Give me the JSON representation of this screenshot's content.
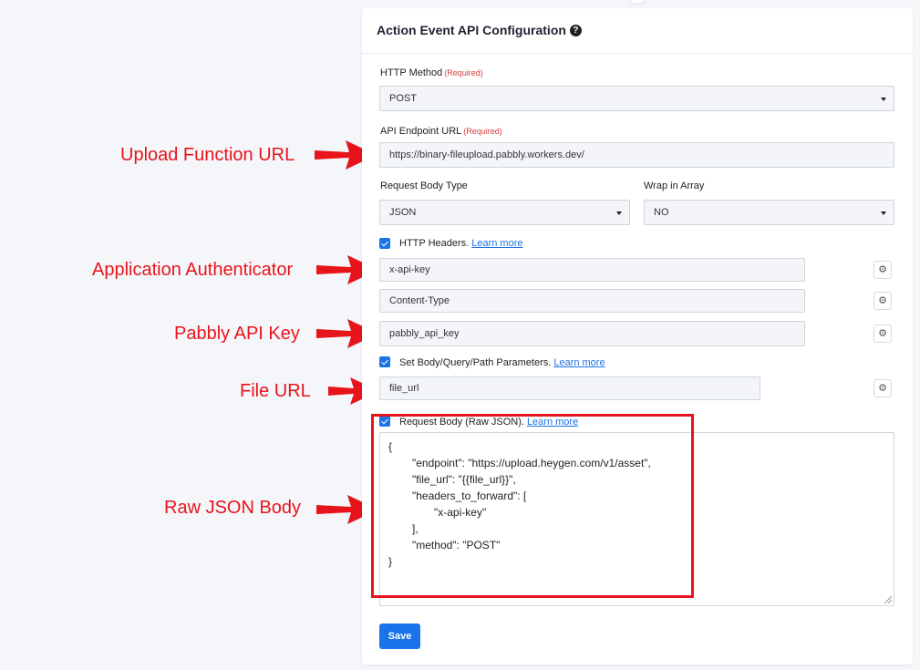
{
  "panel": {
    "title": "Action Event API Configuration",
    "help_icon": "question-circle-icon"
  },
  "http_method": {
    "label": "HTTP Method",
    "required": "(Required)",
    "value": "POST"
  },
  "api_endpoint": {
    "label": "API Endpoint URL",
    "required": "(Required)",
    "value": "https://binary-fileupload.pabbly.workers.dev/"
  },
  "request_body_type": {
    "label": "Request Body Type",
    "value": "JSON"
  },
  "wrap_in_array": {
    "label": "Wrap in Array",
    "value": "NO"
  },
  "http_headers": {
    "label": "HTTP Headers.",
    "learn_more": "Learn more",
    "checked": true,
    "rows": [
      "x-api-key",
      "Content-Type",
      "pabbly_api_key"
    ]
  },
  "params": {
    "label": "Set Body/Query/Path Parameters.",
    "learn_more": "Learn more",
    "checked": true,
    "rows": [
      "file_url"
    ]
  },
  "request_body": {
    "label": "Request Body (Raw JSON).",
    "learn_more": "Learn more",
    "checked": true,
    "lines": [
      "{",
      "\"endpoint\": \"https://upload.heygen.com/v1/asset\",",
      "\"file_url\": \"{{file_url}}\",",
      "\"headers_to_forward\": [",
      "\"x-api-key\"",
      "],",
      "\"method\": \"POST\"",
      "}"
    ]
  },
  "save_label": "Save",
  "annotations": {
    "upload_function_url": "Upload Function URL",
    "application_authenticator": "Application Authenticator",
    "pabbly_api_key": "Pabbly API Key",
    "file_url": "File URL",
    "raw_json_body": "Raw JSON Body"
  },
  "colors": {
    "accent": "#1a73e8",
    "annotation": "#e8141b",
    "required": "#d43c3c"
  }
}
